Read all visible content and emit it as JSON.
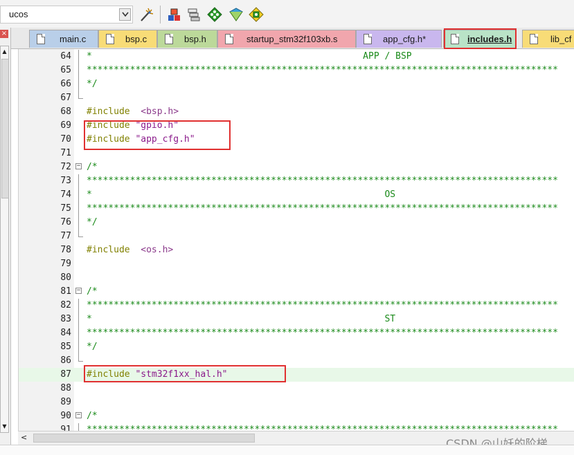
{
  "toolbar": {
    "target": "ucos",
    "buttons": [
      "magic-wand-icon",
      "build-icon",
      "batch-build-icon",
      "debug-diamond-icon",
      "options-icon",
      "pack-installer-icon"
    ]
  },
  "left_panel": {
    "close_glyph": "×"
  },
  "tabs": [
    {
      "label": "main.c",
      "color": "#b9cfe9",
      "active": false
    },
    {
      "label": "bsp.c",
      "color": "#f8dc77",
      "active": false
    },
    {
      "label": "bsp.h",
      "color": "#bcd99a",
      "active": false
    },
    {
      "label": "startup_stm32f103xb.s",
      "color": "#f1a6ad",
      "active": false
    },
    {
      "label": "app_cfg.h*",
      "color": "#c9b7ee",
      "active": false
    },
    {
      "label": "includes.h",
      "color": "#b9e3c7",
      "active": true
    },
    {
      "label": "lib_cf",
      "color": "#f8dc77",
      "active": false
    }
  ],
  "editor": {
    "lines": [
      {
        "n": "64",
        "parts": [
          {
            "t": "*                                                  APP / BSP",
            "c": "comment"
          }
        ]
      },
      {
        "n": "65",
        "parts": [
          {
            "t": "***************************************************************************************",
            "c": "comment"
          }
        ]
      },
      {
        "n": "66",
        "parts": [
          {
            "t": "*/",
            "c": "comment"
          }
        ]
      },
      {
        "n": "67",
        "parts": []
      },
      {
        "n": "68",
        "parts": [
          {
            "t": "#include  ",
            "c": "pp"
          },
          {
            "t": "<bsp.h>",
            "c": "sys"
          }
        ]
      },
      {
        "n": "69",
        "parts": [
          {
            "t": "#include ",
            "c": "pp"
          },
          {
            "t": "\"gpio.h\"",
            "c": "str"
          }
        ]
      },
      {
        "n": "70",
        "parts": [
          {
            "t": "#include ",
            "c": "pp"
          },
          {
            "t": "\"app_cfg.h\"",
            "c": "str"
          }
        ]
      },
      {
        "n": "71",
        "parts": []
      },
      {
        "n": "72",
        "parts": [
          {
            "t": "/*",
            "c": "comment"
          }
        ]
      },
      {
        "n": "73",
        "parts": [
          {
            "t": "***************************************************************************************",
            "c": "comment"
          }
        ]
      },
      {
        "n": "74",
        "parts": [
          {
            "t": "*                                                      OS",
            "c": "comment"
          }
        ]
      },
      {
        "n": "75",
        "parts": [
          {
            "t": "***************************************************************************************",
            "c": "comment"
          }
        ]
      },
      {
        "n": "76",
        "parts": [
          {
            "t": "*/",
            "c": "comment"
          }
        ]
      },
      {
        "n": "77",
        "parts": []
      },
      {
        "n": "78",
        "parts": [
          {
            "t": "#include  ",
            "c": "pp"
          },
          {
            "t": "<os.h>",
            "c": "sys"
          }
        ]
      },
      {
        "n": "79",
        "parts": []
      },
      {
        "n": "80",
        "parts": []
      },
      {
        "n": "81",
        "parts": [
          {
            "t": "/*",
            "c": "comment"
          }
        ]
      },
      {
        "n": "82",
        "parts": [
          {
            "t": "***************************************************************************************",
            "c": "comment"
          }
        ]
      },
      {
        "n": "83",
        "parts": [
          {
            "t": "*                                                      ST",
            "c": "comment"
          }
        ]
      },
      {
        "n": "84",
        "parts": [
          {
            "t": "***************************************************************************************",
            "c": "comment"
          }
        ]
      },
      {
        "n": "85",
        "parts": [
          {
            "t": "*/",
            "c": "comment"
          }
        ]
      },
      {
        "n": "86",
        "parts": []
      },
      {
        "n": "87",
        "parts": [
          {
            "t": "#include ",
            "c": "pp"
          },
          {
            "t": "\"stm32f1xx_hal.h\"",
            "c": "str"
          }
        ]
      },
      {
        "n": "88",
        "parts": []
      },
      {
        "n": "89",
        "parts": []
      },
      {
        "n": "90",
        "parts": [
          {
            "t": "/*",
            "c": "comment"
          }
        ]
      },
      {
        "n": "91",
        "parts": [
          {
            "t": "***************************************************************************************",
            "c": "comment"
          }
        ]
      }
    ]
  },
  "watermark": "CSDN @山妖的阶梯",
  "colors": {
    "comment": "#1a8a1a",
    "preprocessor": "#808000",
    "string": "#8b1a8b",
    "highlight": "#e03030"
  }
}
